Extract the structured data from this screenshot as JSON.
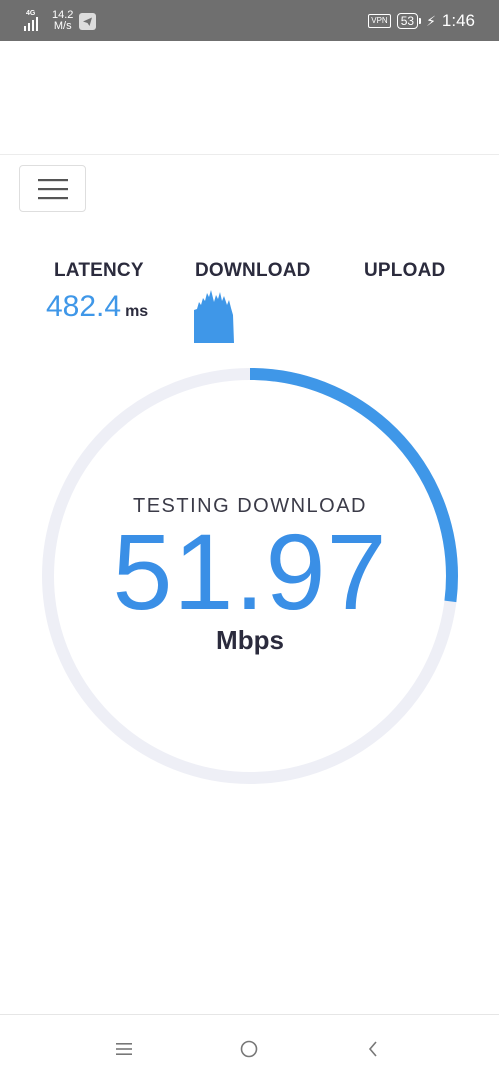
{
  "status_bar": {
    "network": "4G",
    "speed_value": "14.2",
    "speed_unit": "M/s",
    "vpn": "VPN",
    "battery": "53",
    "time": "1:46",
    "icons": [
      "signal-icon",
      "telegram-icon",
      "vpn-icon",
      "battery-icon",
      "charging-icon"
    ]
  },
  "metrics": {
    "latency": {
      "label": "LATENCY",
      "value": "482.4",
      "unit": "ms"
    },
    "download": {
      "label": "DOWNLOAD"
    },
    "upload": {
      "label": "UPLOAD"
    }
  },
  "gauge": {
    "status_text": "TESTING DOWNLOAD",
    "value": "51.97",
    "unit": "Mbps",
    "progress_fraction": 0.27,
    "track_color": "#eeeff6",
    "progress_color": "#3f97e8"
  },
  "nav_bar": {
    "icons": [
      "menu-icon",
      "home-icon",
      "back-icon"
    ]
  },
  "colors": {
    "accent": "#3f97e8",
    "text_dark": "#2b2b3d",
    "status_bar_bg": "#6f6f6f"
  }
}
